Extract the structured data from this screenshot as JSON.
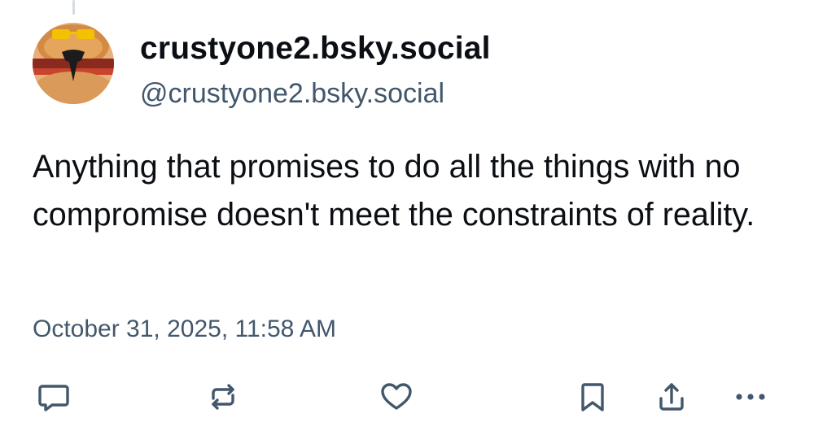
{
  "post": {
    "author": {
      "display_name": "crustyone2.bsky.social",
      "handle": "@crustyone2.bsky.social",
      "avatar_icon": "avatar-burger-icon"
    },
    "text": "Anything that promises to do all the things with no compromise doesn't meet the constraints of reality.",
    "timestamp": "October 31, 2025, 11:58 AM"
  },
  "actions": [
    {
      "name": "reply",
      "icon": "reply-icon"
    },
    {
      "name": "repost",
      "icon": "repost-icon"
    },
    {
      "name": "like",
      "icon": "heart-icon"
    },
    {
      "name": "bookmark",
      "icon": "bookmark-icon"
    },
    {
      "name": "share",
      "icon": "share-icon"
    },
    {
      "name": "more",
      "icon": "more-icon"
    }
  ],
  "colors": {
    "text_primary": "#0b0f14",
    "text_secondary": "#42576c",
    "icon": "#42576c",
    "thread_line": "#d4dbe2"
  }
}
